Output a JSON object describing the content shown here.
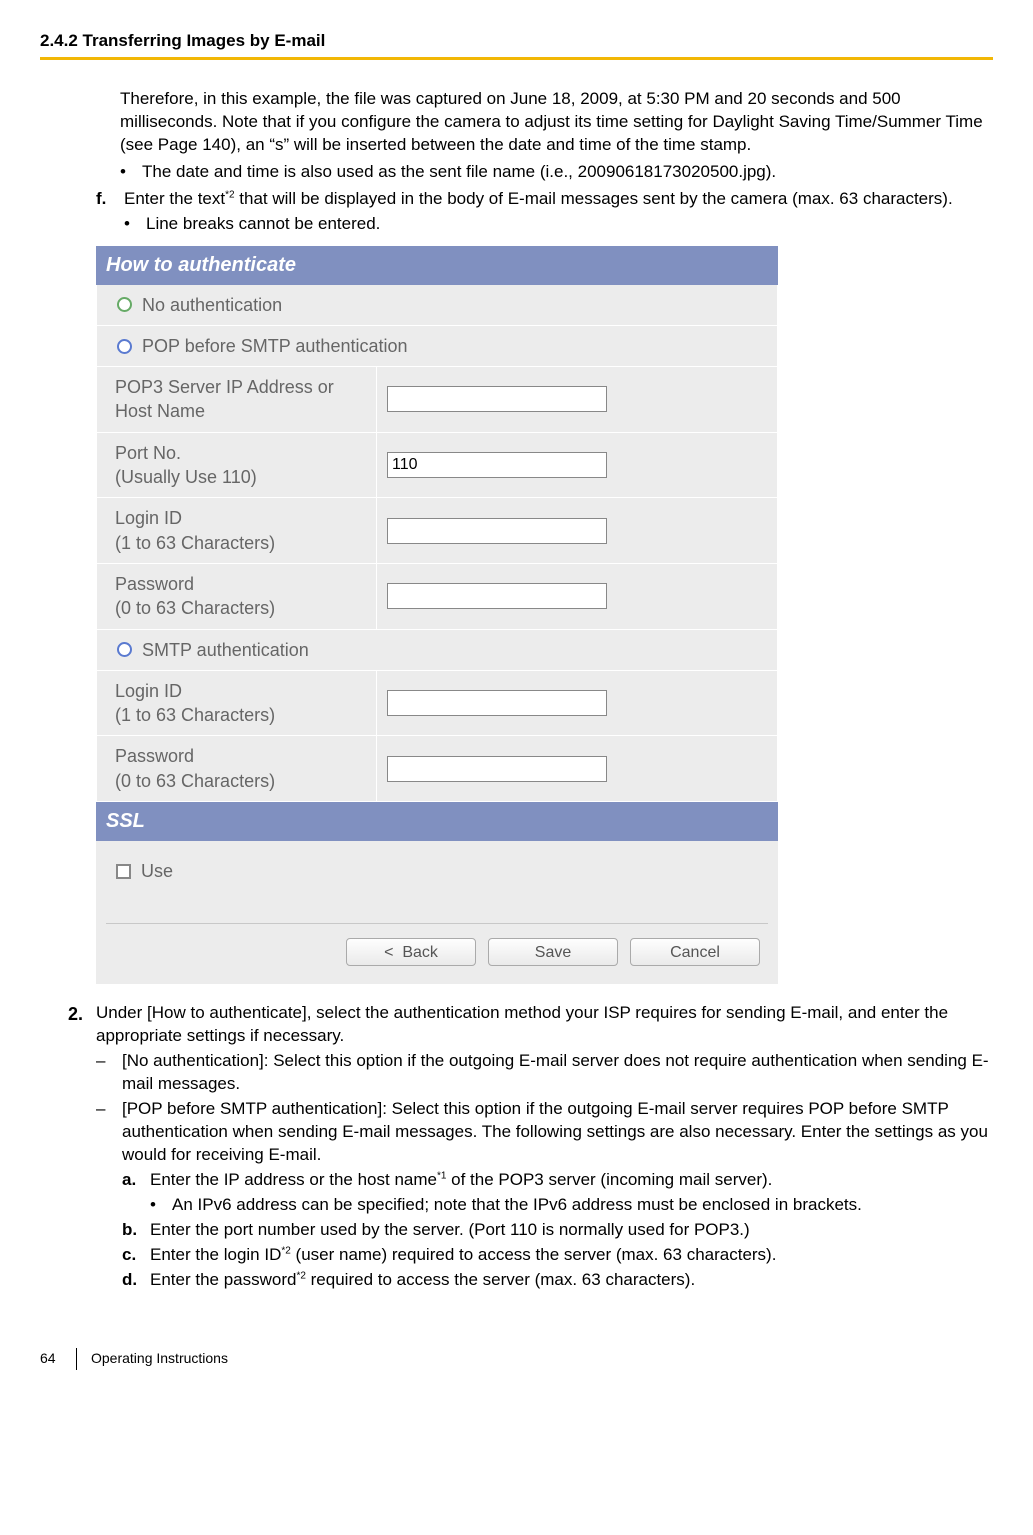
{
  "header": {
    "section_number": "2.4.2 Transferring Images by E-mail"
  },
  "paragraphs": {
    "intro": "Therefore, in this example, the file was captured on June 18, 2009, at 5:30 PM and 20 seconds and 500 milliseconds. Note that if you configure the camera to adjust its time setting for Daylight Saving Time/Summer Time (see Page 140), an “s” will be inserted between the date and time of the time stamp.",
    "intro_bullet": "The date and time is also used as the sent file name (i.e., 20090618173020500.jpg).",
    "step_f_prefix": "Enter the text",
    "step_f_sup": "*2",
    "step_f_suffix": " that will be displayed in the body of E-mail messages sent by the camera (max. 63 characters).",
    "step_f_bullet": "Line breaks cannot be entered.",
    "step2": "Under [How to authenticate], select the authentication method your ISP requires for sending E-mail, and enter the appropriate settings if necessary.",
    "step2_dash1": "[No authentication]: Select this option if the outgoing E-mail server does not require authentication when sending E-mail messages.",
    "step2_dash2": "[POP before SMTP authentication]: Select this option if the outgoing E-mail server requires POP before SMTP authentication when sending E-mail messages. The following settings are also necessary. Enter the settings as you would for receiving E-mail.",
    "sub_a_prefix": "Enter the IP address or the host name",
    "sub_a_sup": "*1",
    "sub_a_suffix": " of the POP3 server (incoming mail server).",
    "sub_a_bullet": "An IPv6 address can be specified; note that the IPv6 address must be enclosed in brackets.",
    "sub_b": "Enter the port number used by the server. (Port 110 is normally used for POP3.)",
    "sub_c_prefix": "Enter the login ID",
    "sub_c_sup": "*2",
    "sub_c_suffix": " (user name) required to access the server (max. 63 characters).",
    "sub_d_prefix": "Enter the password",
    "sub_d_sup": "*2",
    "sub_d_suffix": " required to access the server (max. 63 characters)."
  },
  "markers": {
    "f": "f.",
    "two": "2.",
    "a": "a.",
    "b": "b.",
    "c": "c.",
    "d": "d.",
    "bullet": "•",
    "dash": "–"
  },
  "ui": {
    "auth_header": "How to authenticate",
    "ssl_header": "SSL",
    "no_auth": "No authentication",
    "pop_before_smtp": "POP before SMTP authentication",
    "smtp_auth": "SMTP authentication",
    "pop3_server": "POP3 Server IP Address or Host Name",
    "port_no": "Port No.\n(Usually Use 110)",
    "login_id": "Login ID\n(1 to 63 Characters)",
    "password": "Password\n(0 to 63 Characters)",
    "port_value": "110",
    "use": "Use",
    "back": "<  Back",
    "save": "Save",
    "cancel": "Cancel"
  },
  "footer": {
    "page": "64",
    "title": "Operating Instructions"
  }
}
